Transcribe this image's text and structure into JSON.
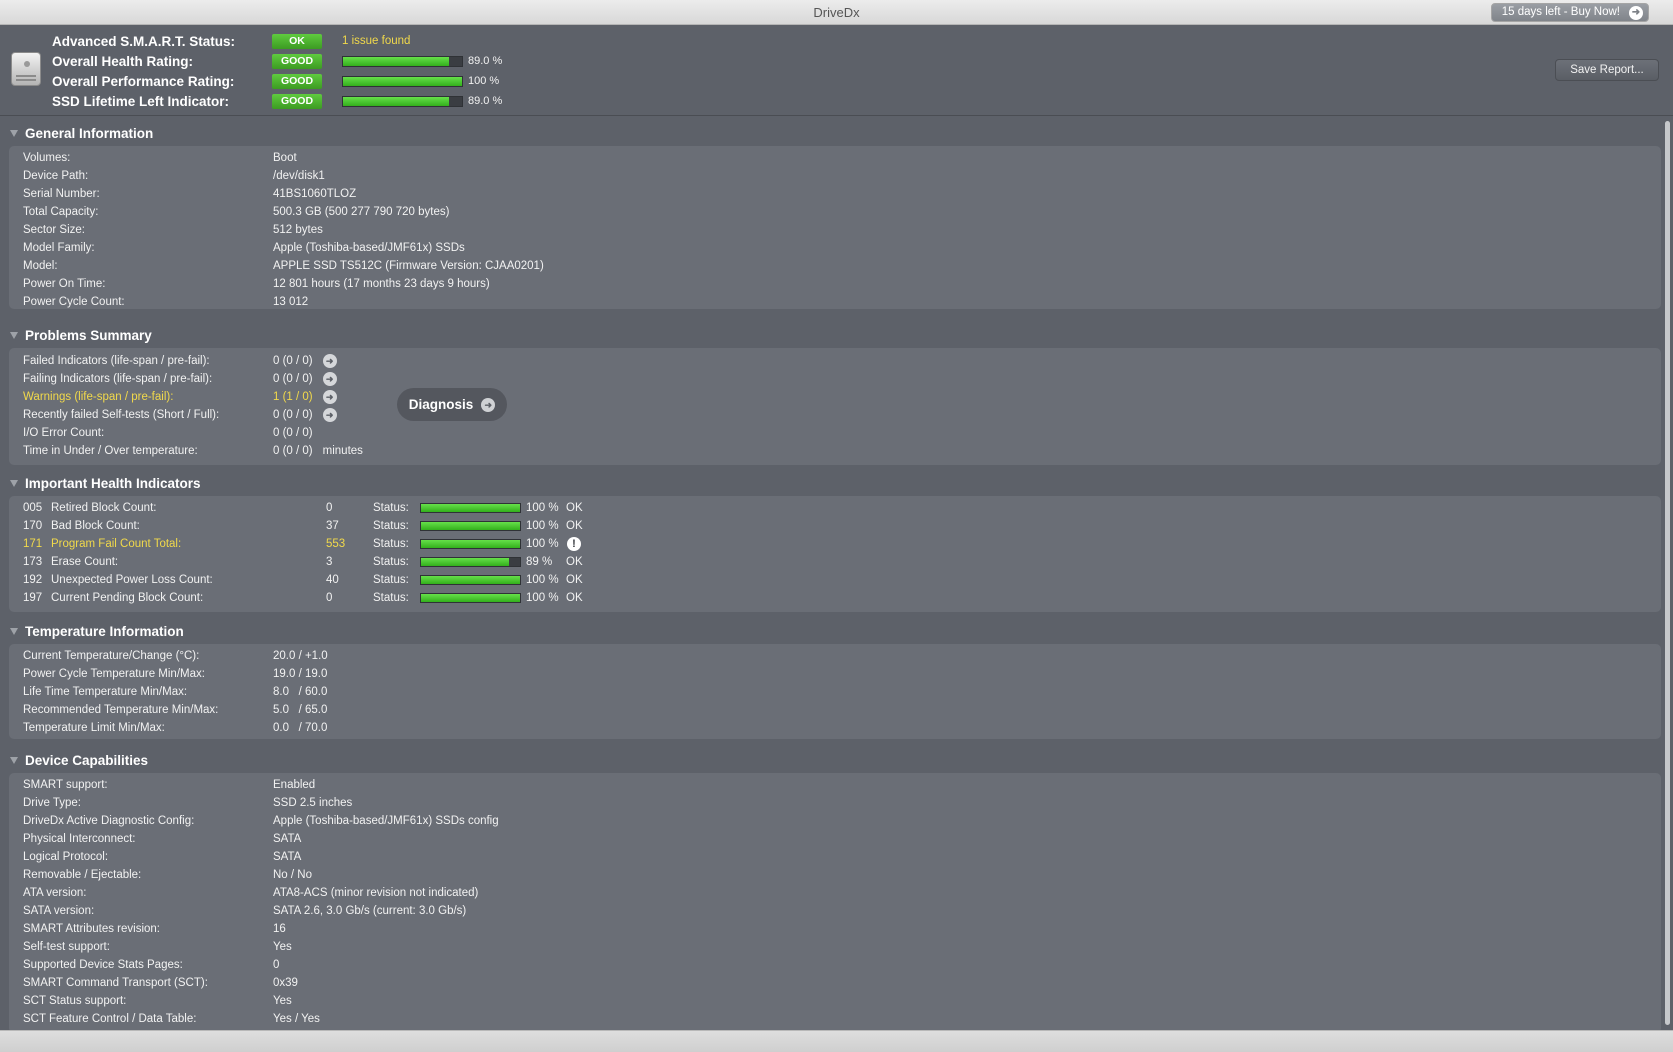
{
  "window": {
    "title": "DriveDx",
    "buy_label": "15 days left - Buy Now!"
  },
  "header": {
    "rows": [
      {
        "label": "Advanced S.M.A.R.T. Status:",
        "badge": "OK",
        "issue": "1 issue found"
      },
      {
        "label": "Overall Health Rating:",
        "badge": "GOOD",
        "percent_text": "89.0 %",
        "level": 89.0
      },
      {
        "label": "Overall Performance Rating:",
        "badge": "GOOD",
        "percent_text": "100 %",
        "level": 100
      },
      {
        "label": "SSD Lifetime Left Indicator:",
        "badge": "GOOD",
        "percent_text": "89.0 %",
        "level": 89.0
      }
    ],
    "save_label": "Save Report..."
  },
  "general": {
    "title": "General Information",
    "rows": [
      {
        "label": "Volumes:",
        "value": "Boot"
      },
      {
        "label": "Device Path:",
        "value": "/dev/disk1"
      },
      {
        "label": "Serial Number:",
        "value": "41BS1060TLOZ"
      },
      {
        "label": "Total Capacity:",
        "value": "500.3 GB (500 277 790 720 bytes)"
      },
      {
        "label": "Sector Size:",
        "value": "512 bytes"
      },
      {
        "label": "Model Family:",
        "value": "Apple (Toshiba-based/JMF61x) SSDs"
      },
      {
        "label": "Model:",
        "value": "APPLE SSD TS512C  (Firmware Version: CJAA0201)"
      },
      {
        "label": "Power On Time:",
        "value": "12 801 hours (17 months 23 days 9 hours)"
      },
      {
        "label": "Power Cycle Count:",
        "value": "13 012"
      }
    ]
  },
  "problems": {
    "title": "Problems Summary",
    "rows": [
      {
        "label": "Failed Indicators (life-span / pre-fail):",
        "value": "0 (0 / 0)",
        "warning": false
      },
      {
        "label": "Failing Indicators (life-span / pre-fail):",
        "value": "0 (0 / 0)",
        "warning": false
      },
      {
        "label": "Warnings (life-span / pre-fail):",
        "value": "1 (1 / 0)",
        "warning": true
      },
      {
        "label": "Recently failed Self-tests (Short / Full):",
        "value": "0 (0 / 0)",
        "warning": false
      },
      {
        "label": "I/O Error Count:",
        "value": "0 (0 / 0)",
        "warning": false
      },
      {
        "label": "Time in Under / Over temperature:",
        "value": "0 (0 / 0)",
        "suffix": "minutes",
        "warning": false
      }
    ],
    "diagnosis_label": "Diagnosis"
  },
  "health": {
    "title": "Important Health Indicators",
    "status_label": "Status:",
    "rows": [
      {
        "id": "005",
        "label": "Retired Block Count:",
        "value": "0",
        "level": 100,
        "percent_text": "100 %",
        "result": "OK",
        "warning": false
      },
      {
        "id": "170",
        "label": "Bad Block Count:",
        "value": "37",
        "level": 100,
        "percent_text": "100 %",
        "result": "OK",
        "warning": false
      },
      {
        "id": "171",
        "label": "Program Fail Count Total:",
        "value": "553",
        "level": 100,
        "percent_text": "100 %",
        "result": "!",
        "warning": true
      },
      {
        "id": "173",
        "label": "Erase Count:",
        "value": "3",
        "level": 89,
        "percent_text": "89 %",
        "result": "OK",
        "warning": false
      },
      {
        "id": "192",
        "label": "Unexpected Power Loss Count:",
        "value": "40",
        "level": 100,
        "percent_text": "100 %",
        "result": "OK",
        "warning": false
      },
      {
        "id": "197",
        "label": "Current Pending Block Count:",
        "value": "0",
        "level": 100,
        "percent_text": "100 %",
        "result": "OK",
        "warning": false
      }
    ]
  },
  "temperature": {
    "title": "Temperature Information",
    "rows": [
      {
        "label": "Current Temperature/Change (°C):",
        "value": "20.0 / +1.0"
      },
      {
        "label": "Power Cycle Temperature Min/Max:",
        "value": "19.0 / 19.0"
      },
      {
        "label": "Life Time Temperature Min/Max:",
        "value": "8.0   / 60.0"
      },
      {
        "label": "Recommended Temperature Min/Max:",
        "value": "5.0   / 65.0"
      },
      {
        "label": "Temperature Limit Min/Max:",
        "value": "0.0   / 70.0"
      }
    ]
  },
  "capabilities": {
    "title": "Device Capabilities",
    "rows": [
      {
        "label": "SMART support:",
        "value": "Enabled"
      },
      {
        "label": "Drive Type:",
        "value": "SSD 2.5 inches"
      },
      {
        "label": "DriveDx Active Diagnostic Config:",
        "value": "Apple (Toshiba-based/JMF61x) SSDs config"
      },
      {
        "label": "Physical Interconnect:",
        "value": "SATA"
      },
      {
        "label": "Logical Protocol:",
        "value": "SATA"
      },
      {
        "label": "Removable / Ejectable:",
        "value": "No / No"
      },
      {
        "label": "ATA version:",
        "value": "ATA8-ACS (minor revision not indicated)"
      },
      {
        "label": "SATA version:",
        "value": "SATA 2.6, 3.0 Gb/s (current: 3.0 Gb/s)"
      },
      {
        "label": "SMART Attributes revision:",
        "value": "16"
      },
      {
        "label": "Self-test support:",
        "value": "Yes"
      },
      {
        "label": "Supported Device Stats Pages:",
        "value": "0"
      },
      {
        "label": "SMART Command Transport (SCT):",
        "value": "0x39"
      },
      {
        "label": "SCT Status support:",
        "value": "Yes"
      },
      {
        "label": "SCT Feature Control / Data Table:",
        "value": "Yes / Yes"
      }
    ]
  }
}
